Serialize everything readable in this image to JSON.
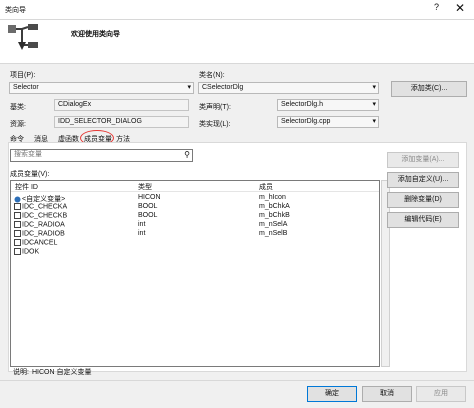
{
  "window": {
    "title": "类向导",
    "help": "?",
    "close": "✕"
  },
  "header": {
    "welcome": "欢迎使用类向导"
  },
  "project": {
    "label": "项目(P):",
    "value": "Selector"
  },
  "classname": {
    "label": "类名(N):",
    "value": "CSelectorDlg"
  },
  "add_class_button": "添加类(C)...",
  "base_class": {
    "label": "基类:",
    "value": "CDialogEx"
  },
  "resource": {
    "label": "资源:",
    "value": "IDD_SELECTOR_DIALOG"
  },
  "class_decl": {
    "label": "类声明(T):",
    "value": "SelectorDlg.h"
  },
  "class_impl": {
    "label": "类实现(L):",
    "value": "SelectorDlg.cpp"
  },
  "tabs": [
    {
      "label": "命令"
    },
    {
      "label": "消息"
    },
    {
      "label": "虚函数"
    },
    {
      "label": "成员变量"
    },
    {
      "label": "方法"
    }
  ],
  "search": {
    "placeholder": "搜索变量"
  },
  "members_label": "成员变量(V):",
  "columns": [
    "控件 ID",
    "类型",
    "成员"
  ],
  "rows": [
    {
      "id": "<自定义变量>",
      "type": "HICON",
      "member": "m_hIcon",
      "icon": "var-icon"
    },
    {
      "id": "IDC_CHECKA",
      "type": "BOOL",
      "member": "m_bChkA",
      "icon": "control-icon"
    },
    {
      "id": "IDC_CHECKB",
      "type": "BOOL",
      "member": "m_bChkB",
      "icon": "control-icon"
    },
    {
      "id": "IDC_RADIOA",
      "type": "int",
      "member": "m_nSelA",
      "icon": "control-icon"
    },
    {
      "id": "IDC_RADIOB",
      "type": "int",
      "member": "m_nSelB",
      "icon": "control-icon"
    },
    {
      "id": "IDCANCEL",
      "type": "",
      "member": "",
      "icon": "control-icon"
    },
    {
      "id": "IDOK",
      "type": "",
      "member": "",
      "icon": "control-icon"
    }
  ],
  "side_buttons": {
    "add_variable": "添加变量(A)...",
    "add_custom": "添加自定义(U)...",
    "delete_variable": "删除变量(D)",
    "edit_code": "编辑代码(E)"
  },
  "description": {
    "label": "说明:",
    "value": "HICON 自定义变量"
  },
  "footer": {
    "ok": "确定",
    "cancel": "取消",
    "apply": "应用"
  },
  "colors": {
    "annotation": "#e53935",
    "ok_border": "#0078d7"
  }
}
